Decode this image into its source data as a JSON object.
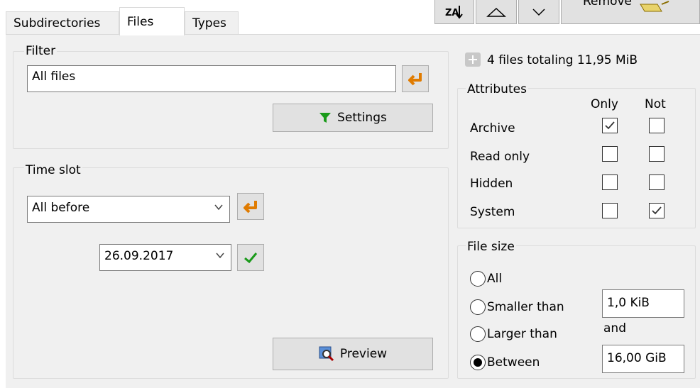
{
  "tabs": [
    {
      "label": "Subdirectories"
    },
    {
      "label": "Files"
    },
    {
      "label": "Types"
    }
  ],
  "toolbar": {
    "remove_label": "Remove"
  },
  "filter": {
    "legend": "Filter",
    "value": "All files",
    "settings_label": "Settings"
  },
  "timeslot": {
    "legend": "Time slot",
    "mode": "All before",
    "date": "26.09.2017",
    "preview_label": "Preview"
  },
  "summary": {
    "text": "4 files totaling 11,95 MiB"
  },
  "attributes": {
    "legend": "Attributes",
    "col_only": "Only",
    "col_not": "Not",
    "rows": [
      {
        "label": "Archive",
        "only": true,
        "not": false
      },
      {
        "label": "Read only",
        "only": false,
        "not": false
      },
      {
        "label": "Hidden",
        "only": false,
        "not": false
      },
      {
        "label": "System",
        "only": false,
        "not": true
      }
    ]
  },
  "filesize": {
    "legend": "File size",
    "options": [
      {
        "label": "All",
        "selected": false
      },
      {
        "label": "Smaller than",
        "selected": false
      },
      {
        "label": "Larger than",
        "selected": false
      },
      {
        "label": "Between",
        "selected": true
      }
    ],
    "min_value": "1,0 KiB",
    "and_label": "and",
    "max_value": "16,00 GiB"
  },
  "colors": {
    "accent_green": "#1a9a1a",
    "enter_orange": "#e07b00",
    "panel_bg": "#f0f0f0"
  }
}
